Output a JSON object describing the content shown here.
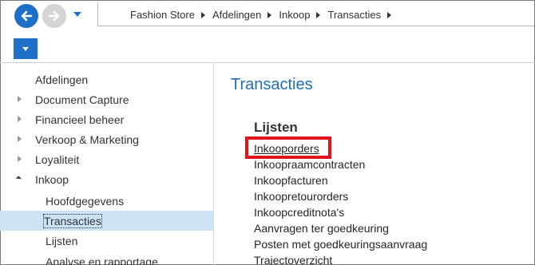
{
  "breadcrumb": {
    "items": [
      "Fashion Store",
      "Afdelingen",
      "Inkoop",
      "Transacties"
    ]
  },
  "nav_pane": {
    "items": [
      {
        "label": "Afdelingen",
        "expander": "none",
        "indent": 0
      },
      {
        "label": "Document Capture",
        "expander": "collapsed",
        "indent": 0
      },
      {
        "label": "Financieel beheer",
        "expander": "collapsed",
        "indent": 0
      },
      {
        "label": "Verkoop & Marketing",
        "expander": "collapsed",
        "indent": 0
      },
      {
        "label": "Loyaliteit",
        "expander": "collapsed",
        "indent": 0
      },
      {
        "label": "Inkoop",
        "expander": "expanded",
        "indent": 0
      },
      {
        "label": "Hoofdgegevens",
        "expander": "none",
        "indent": 1
      },
      {
        "label": "Transacties",
        "expander": "none",
        "indent": 1,
        "selected": true
      },
      {
        "label": "Lijsten",
        "expander": "none",
        "indent": 1
      },
      {
        "label": "Analyse en rapportage",
        "expander": "none",
        "indent": 1
      }
    ]
  },
  "content": {
    "title": "Transacties",
    "section_title": "Lijsten",
    "links": [
      "Inkooporders",
      "Inkoopraamcontracten",
      "Inkoopfacturen",
      "Inkoopretourorders",
      "Inkoopcreditnota's",
      "Aanvragen ter goedkeuring",
      "Posten met goedkeuringsaanvraag",
      "Trajectoverzicht"
    ],
    "highlighted_link": "Inkooporders"
  },
  "colors": {
    "accent": "#1e6fc7",
    "title": "#1f6fb5",
    "selection": "#cde3f6",
    "highlight_box": "#e2131b"
  },
  "icons": {
    "back": "arrow-left-icon",
    "forward": "arrow-right-icon",
    "history": "chevron-down-icon",
    "ribbon": "chevron-down-icon"
  }
}
